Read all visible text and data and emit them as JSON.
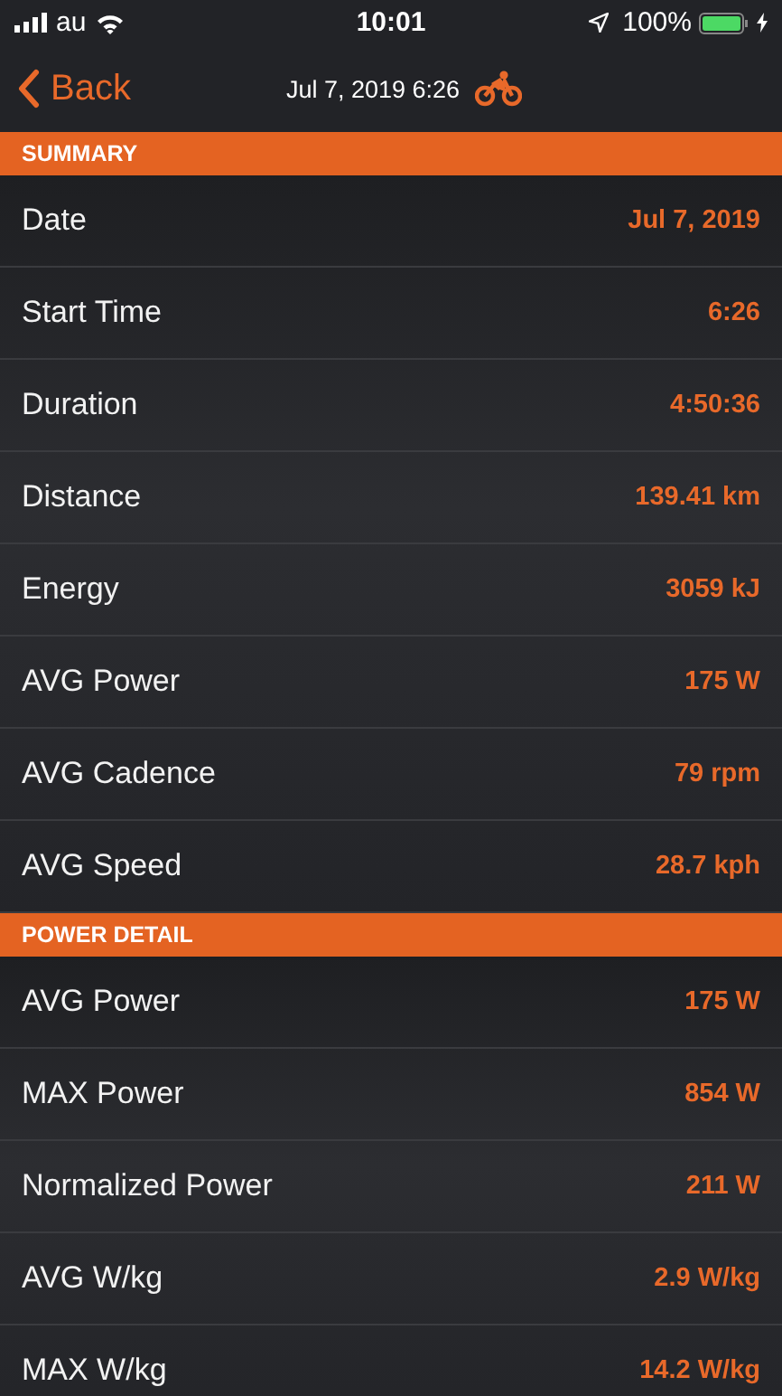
{
  "status_bar": {
    "carrier": "au",
    "time": "10:01",
    "battery_percent": "100%"
  },
  "nav": {
    "back": "Back",
    "title": "Jul 7, 2019 6:26"
  },
  "sections": [
    {
      "title": "SUMMARY",
      "rows": [
        {
          "label": "Date",
          "value": "Jul 7, 2019"
        },
        {
          "label": "Start Time",
          "value": "6:26"
        },
        {
          "label": "Duration",
          "value": "4:50:36"
        },
        {
          "label": "Distance",
          "value": "139.41 km"
        },
        {
          "label": "Energy",
          "value": "3059 kJ"
        },
        {
          "label": "AVG Power",
          "value": "175 W"
        },
        {
          "label": "AVG Cadence",
          "value": "79 rpm"
        },
        {
          "label": "AVG Speed",
          "value": "28.7 kph"
        }
      ]
    },
    {
      "title": "POWER DETAIL",
      "rows": [
        {
          "label": "AVG Power",
          "value": "175 W"
        },
        {
          "label": "MAX Power",
          "value": "854 W"
        },
        {
          "label": "Normalized Power",
          "value": "211 W"
        },
        {
          "label": "AVG W/kg",
          "value": "2.9 W/kg"
        },
        {
          "label": "MAX W/kg",
          "value": "14.2 W/kg"
        }
      ]
    }
  ]
}
